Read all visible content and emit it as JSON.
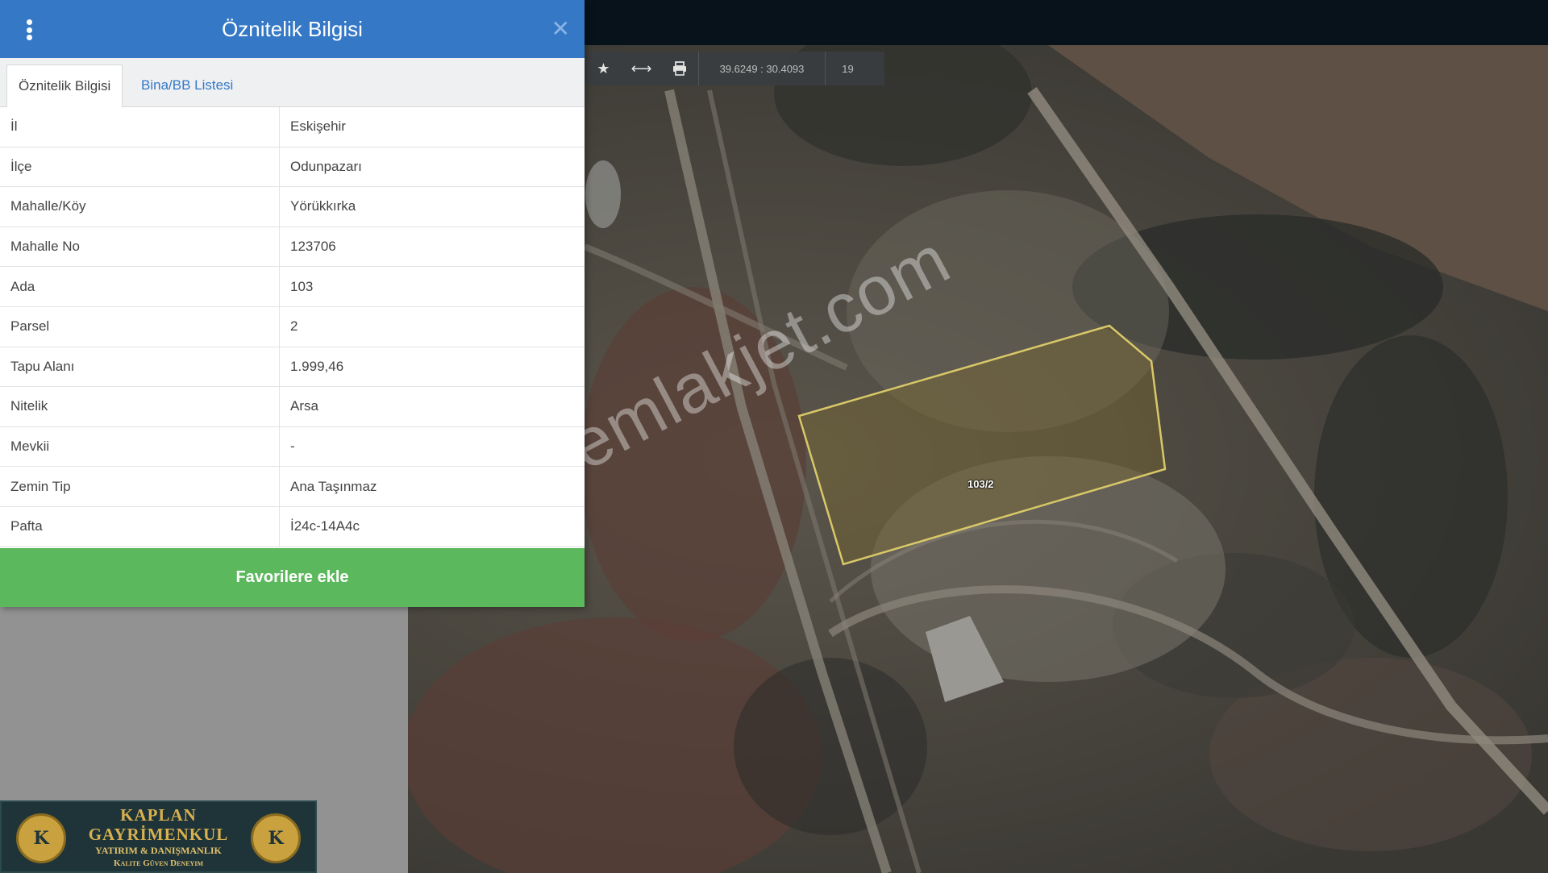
{
  "panel": {
    "title": "Öznitelik Bilgisi",
    "tabs": [
      {
        "label": "Öznitelik Bilgisi",
        "active": true
      },
      {
        "label": "Bina/BB Listesi",
        "active": false
      }
    ],
    "rows": [
      {
        "key": "İl",
        "value": "Eskişehir"
      },
      {
        "key": "İlçe",
        "value": "Odunpazarı"
      },
      {
        "key": "Mahalle/Köy",
        "value": "Yörükkırka"
      },
      {
        "key": "Mahalle No",
        "value": "123706"
      },
      {
        "key": "Ada",
        "value": "103"
      },
      {
        "key": "Parsel",
        "value": "2"
      },
      {
        "key": "Tapu Alanı",
        "value": "1.999,46"
      },
      {
        "key": "Nitelik",
        "value": "Arsa"
      },
      {
        "key": "Mevkii",
        "value": "-"
      },
      {
        "key": "Zemin Tip",
        "value": "Ana Taşınmaz"
      },
      {
        "key": "Pafta",
        "value": "İ24c-14A4c"
      }
    ],
    "favorite_button": "Favorilere ekle",
    "colors": {
      "header": "#3478c6",
      "button": "#5cb85c"
    }
  },
  "map_toolbar": {
    "coords": "39.6249 : 30.4093",
    "zoom": "19",
    "icons": [
      "star-icon",
      "arrows-horizontal-icon",
      "print-icon"
    ]
  },
  "map": {
    "parcel_label": "103/2",
    "watermark": "emlakjet.com"
  },
  "logo": {
    "name1": "KAPLAN",
    "name2": "GAYRİMENKUL",
    "subtitle": "YATIRIM & DANIŞMANLIK",
    "slogan": "Kalite Güven Deneyim"
  }
}
